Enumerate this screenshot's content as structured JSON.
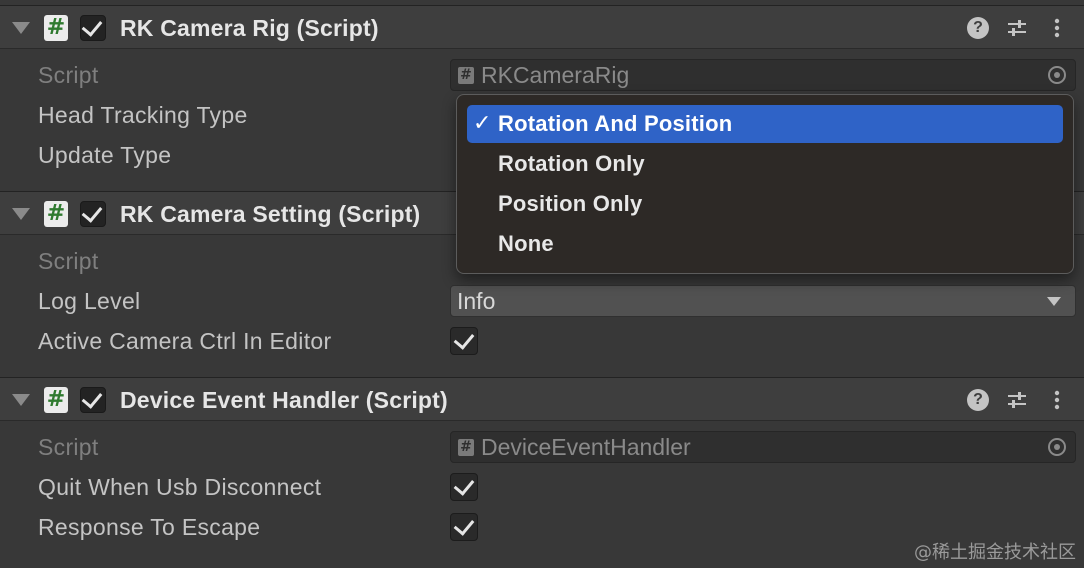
{
  "components": [
    {
      "title": "RK Camera Rig (Script)",
      "enabled": true,
      "fields": {
        "script_label": "Script",
        "script_value": "RKCameraRig",
        "head_tracking_label": "Head Tracking Type",
        "update_type_label": "Update Type"
      }
    },
    {
      "title": "RK Camera Setting (Script)",
      "enabled": true,
      "fields": {
        "script_label": "Script",
        "log_level_label": "Log Level",
        "log_level_value": "Info",
        "active_camera_label": "Active Camera Ctrl In Editor",
        "active_camera_checked": true
      }
    },
    {
      "title": "Device Event Handler (Script)",
      "enabled": true,
      "fields": {
        "script_label": "Script",
        "script_value": "DeviceEventHandler",
        "quit_usb_label": "Quit When Usb Disconnect",
        "quit_usb_checked": true,
        "response_escape_label": "Response To Escape",
        "response_escape_checked": true
      }
    }
  ],
  "popup": {
    "selected_index": 0,
    "check_glyph": "✓",
    "options": [
      "Rotation And Position",
      "Rotation Only",
      "Position Only",
      "None"
    ]
  },
  "icons": {
    "script": "#",
    "help": "?",
    "foldout": "chevron-down-icon",
    "presets": "sliders-icon",
    "menu": "kebab-icon",
    "object_picker": "target-icon"
  },
  "watermark": "@稀土掘金技术社区",
  "colors": {
    "background": "#383838",
    "header": "#3e3e3e",
    "selection": "#2f63c7",
    "script_icon_hash": "#2f7a2f"
  }
}
